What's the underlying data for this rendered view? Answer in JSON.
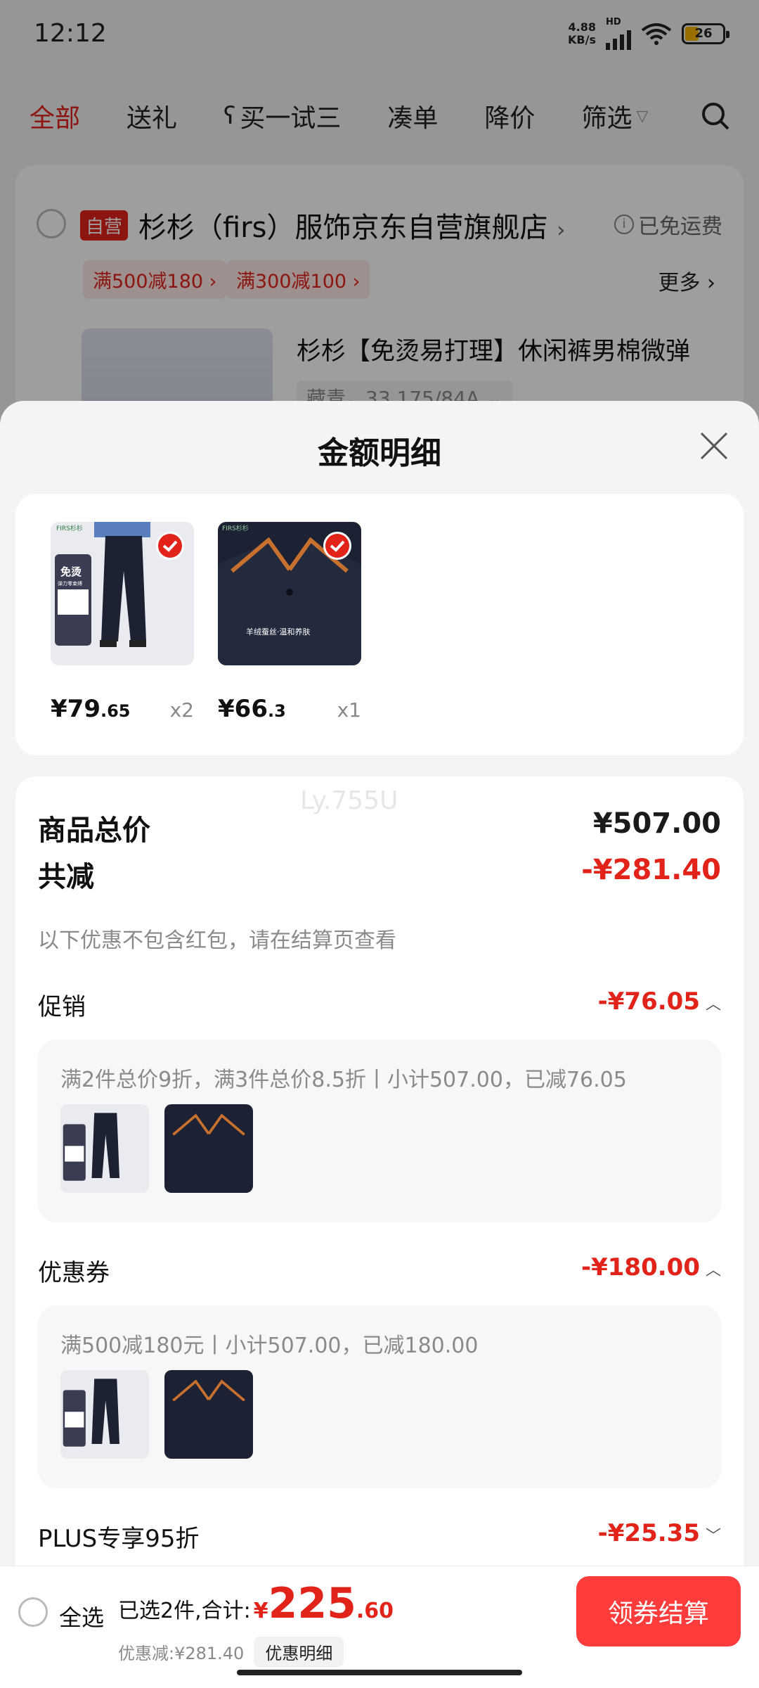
{
  "status_bar": {
    "time": "12:12",
    "net_speed_value": "4.88",
    "net_speed_unit": "KB/s",
    "network_tag": "HD",
    "battery_level": "26"
  },
  "tabs": [
    {
      "label": "全部",
      "active": true
    },
    {
      "label": "送礼",
      "active": false
    },
    {
      "label": "买一试三",
      "active": false
    },
    {
      "label": "凑单",
      "active": false
    },
    {
      "label": "降价",
      "active": false
    },
    {
      "label": "筛选",
      "active": false
    }
  ],
  "store": {
    "self_tag": "自营",
    "name": "杉杉（firs）服饰京东自营旗舰店",
    "arrow": "›",
    "shipping": "已免运费",
    "promos": [
      "满500减180 ›",
      "满300减100 ›"
    ],
    "more": "更多 ›",
    "product_title": "杉杉【免烫易打理】休闲裤男棉微弹",
    "sku": "藏青，33 175/84A ⌄"
  },
  "sheet": {
    "title": "金额明细",
    "goods": [
      {
        "price_int": "¥79",
        "price_dec": ".65",
        "qty": "x2",
        "img": "pants"
      },
      {
        "price_int": "¥66",
        "price_dec": ".3",
        "qty": "x1",
        "img": "shirt"
      }
    ],
    "watermark": "Ly.755U",
    "total_label": "商品总价",
    "total_value": "¥507.00",
    "reduce_label": "共减",
    "reduce_value": "-¥281.40",
    "note": "以下优惠不包含红包，请在结算页查看",
    "promotion": {
      "label": "促销",
      "value": "-¥76.05",
      "desc": "满2件总价9折，满3件总价8.5折丨小计507.00，已减76.05"
    },
    "coupon": {
      "label": "优惠券",
      "value": "-¥180.00",
      "desc": "满500减180元丨小计507.00，已减180.00"
    },
    "plus": {
      "label": "PLUS专享95折",
      "value": "-¥25.35"
    }
  },
  "bottom": {
    "select_all": "全选",
    "selected_text": "已选2件,合计:",
    "yen": "¥",
    "total_int": "225",
    "total_dec": ".60",
    "discount_text": "优惠减:¥281.40",
    "detail_chip": "优惠明细",
    "checkout": "领券结算"
  },
  "colors": {
    "accent": "#e2231a",
    "checkout": "#ff3c3c"
  },
  "image_text": {
    "brand": "FIRS杉杉",
    "pants_tag": "免烫",
    "pants_sub": "弹力零束缚",
    "shirt_slogan": "羊绒蚕丝·温和养肤"
  }
}
